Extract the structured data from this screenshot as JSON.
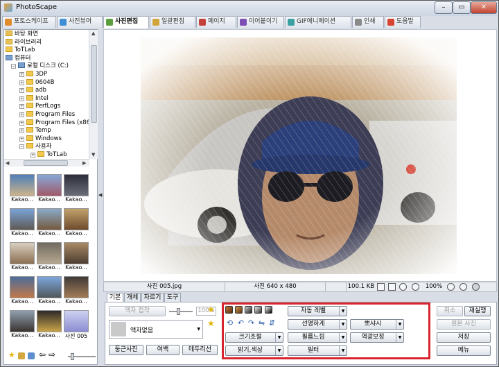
{
  "window": {
    "title": "PhotoScape"
  },
  "tabs": [
    {
      "label": "포토스케이프",
      "color": "#e08b2c",
      "active": false
    },
    {
      "label": "사진뷰어",
      "color": "#3f8fd4",
      "active": false
    },
    {
      "label": "사진편집",
      "color": "#5b9e3e",
      "active": true
    },
    {
      "label": "일괄편집",
      "color": "#d2a53b",
      "active": false
    },
    {
      "label": "페이지",
      "color": "#c4413a",
      "active": false
    },
    {
      "label": "이어붙이기",
      "color": "#7c4fb3",
      "active": false
    },
    {
      "label": "GIF애니메이션",
      "color": "#3aa0a0",
      "active": false
    },
    {
      "label": "인쇄",
      "color": "#8a8a8a",
      "active": false
    },
    {
      "label": "도움말",
      "color": "#d6452f",
      "active": false
    }
  ],
  "tree": [
    {
      "label": "바탕 화면",
      "level": 0,
      "icon": "desktop-icon"
    },
    {
      "label": "라이브러리",
      "level": 0,
      "icon": "library-icon"
    },
    {
      "label": "ToTLab",
      "level": 0,
      "icon": "user-icon"
    },
    {
      "label": "컴퓨터",
      "level": 0,
      "icon": "computer-icon"
    },
    {
      "label": "로컬 디스크 (C:)",
      "level": 1,
      "icon": "drive-icon"
    },
    {
      "label": "3DP",
      "level": 2,
      "icon": "folder-icon"
    },
    {
      "label": "0604B",
      "level": 2,
      "icon": "folder-icon"
    },
    {
      "label": "adb",
      "level": 2,
      "icon": "folder-icon"
    },
    {
      "label": "Intel",
      "level": 2,
      "icon": "folder-icon"
    },
    {
      "label": "PerfLogs",
      "level": 2,
      "icon": "folder-icon"
    },
    {
      "label": "Program Files",
      "level": 2,
      "icon": "folder-icon"
    },
    {
      "label": "Program Files (x86)",
      "level": 2,
      "icon": "folder-icon"
    },
    {
      "label": "Temp",
      "level": 2,
      "icon": "folder-icon"
    },
    {
      "label": "Windows",
      "level": 2,
      "icon": "folder-icon"
    },
    {
      "label": "사용자",
      "level": 2,
      "icon": "folder-icon"
    },
    {
      "label": "ToTLab",
      "level": 3,
      "icon": "folder-icon"
    }
  ],
  "thumbnails": [
    {
      "label": "Kakao...",
      "c1": "#4f7fb8",
      "c2": "#cdb48a"
    },
    {
      "label": "Kakao...",
      "c1": "#86a7d6",
      "c2": "#a25a6a"
    },
    {
      "label": "Kakao...",
      "c1": "#2d2d3a",
      "c2": "#6b6f7a"
    },
    {
      "label": "Kakao...",
      "c1": "#7aa3d8",
      "c2": "#5f5a55"
    },
    {
      "label": "Kakao...",
      "c1": "#8aa9c8",
      "c2": "#735a3e"
    },
    {
      "label": "Kakao...",
      "c1": "#c2a16c",
      "c2": "#6e4b2d"
    },
    {
      "label": "Kakao...",
      "c1": "#d9cfc0",
      "c2": "#8a6f52"
    },
    {
      "label": "Kakao...",
      "c1": "#6f6a60",
      "c2": "#b8a890"
    },
    {
      "label": "Kakao...",
      "c1": "#a88a66",
      "c2": "#4d3d30"
    },
    {
      "label": "Kakao...",
      "c1": "#4d6d9a",
      "c2": "#c07848"
    },
    {
      "label": "Kakao...",
      "c1": "#7ea6dc",
      "c2": "#50575c"
    },
    {
      "label": "Kakao...",
      "c1": "#3f3a38",
      "c2": "#a37c55"
    },
    {
      "label": "Kakao...",
      "c1": "#8fa0b0",
      "c2": "#3a3330"
    },
    {
      "label": "Kakao...",
      "c1": "#2e2a28",
      "c2": "#c9a44a"
    },
    {
      "label": "사진 005",
      "c1": "#cfd2f2",
      "c2": "#8a8cd0"
    }
  ],
  "status": {
    "filename": "사진 005.jpg",
    "dimensions": "사진 640 x 480",
    "filesize": "100.1 KB",
    "zoom": "100%"
  },
  "bottom_tabs": [
    "기본",
    "개체",
    "자르기",
    "도구"
  ],
  "left_controls": {
    "frame_combine": "액자 접착",
    "percent": "100%",
    "frame_none": "액자없음",
    "round_photo": "둥근사진",
    "margin": "여백",
    "border": "테두리선"
  },
  "center_controls": {
    "auto_level": "자동 레벨",
    "sharpen": "선명하게",
    "resize": "크기조절",
    "film_effect": "필름느낌",
    "brightness_color": "밝기,색상",
    "filter": "필터",
    "bloom": "뽀샤시",
    "backlight": "역광보정"
  },
  "right_controls": {
    "undo": "취소",
    "redo": "재실행",
    "original": "원본 사진",
    "save": "저장",
    "menu": "메뉴"
  },
  "colors": {
    "highlight_box": "#d9242f",
    "accent": "#2c5ca8"
  }
}
